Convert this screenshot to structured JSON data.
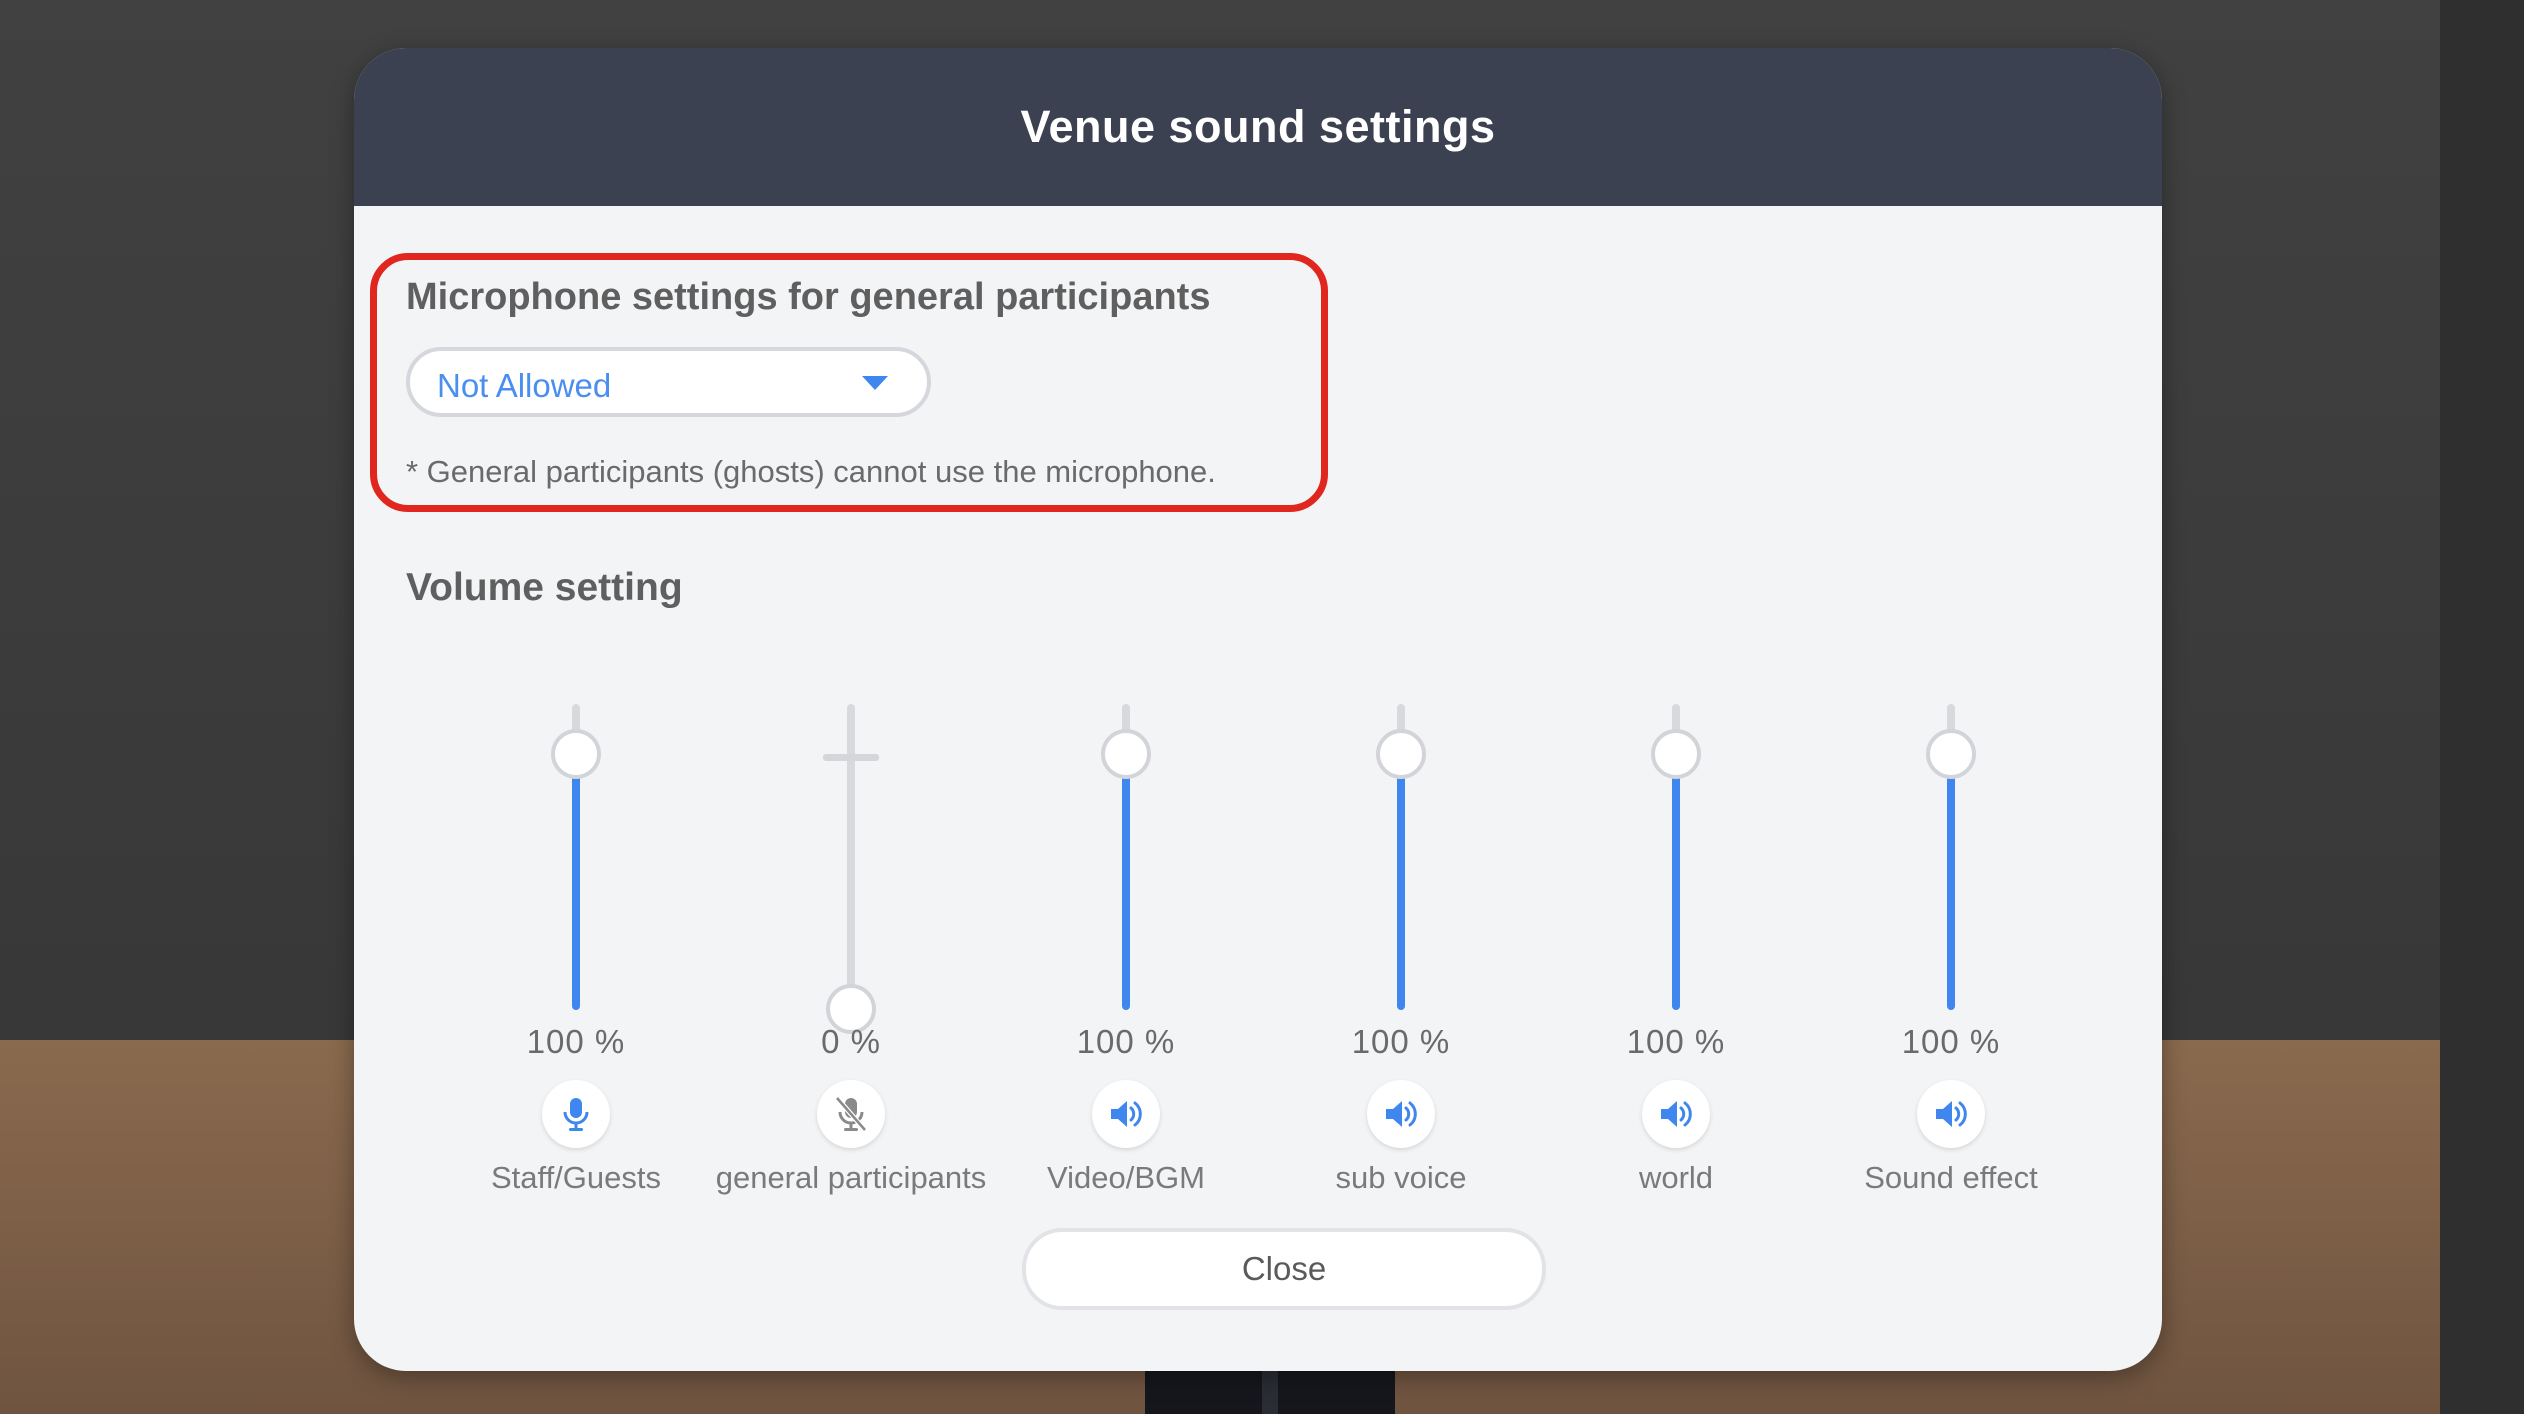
{
  "modal": {
    "title": "Venue sound settings"
  },
  "microphone": {
    "heading": "Microphone settings for general participants",
    "selected": "Not Allowed",
    "note": "* General participants (ghosts) cannot use the microphone."
  },
  "volume": {
    "heading": "Volume setting",
    "channels": [
      {
        "label": "Staff/Guests",
        "value": 100,
        "value_text": "100 %",
        "icon": "microphone-icon",
        "enabled": true
      },
      {
        "label": "general participants",
        "value": 0,
        "value_text": "0 %",
        "icon": "microphone-muted-icon",
        "enabled": false
      },
      {
        "label": "Video/BGM",
        "value": 100,
        "value_text": "100 %",
        "icon": "speaker-icon",
        "enabled": true
      },
      {
        "label": "sub voice",
        "value": 100,
        "value_text": "100 %",
        "icon": "speaker-icon",
        "enabled": true
      },
      {
        "label": "world",
        "value": 100,
        "value_text": "100 %",
        "icon": "speaker-icon",
        "enabled": true
      },
      {
        "label": "Sound effect",
        "value": 100,
        "value_text": "100 %",
        "icon": "speaker-icon",
        "enabled": true
      }
    ]
  },
  "footer": {
    "close_label": "Close"
  },
  "colors": {
    "accent": "#3f86ee",
    "header": "#3b4150",
    "highlight": "#e0261f"
  }
}
